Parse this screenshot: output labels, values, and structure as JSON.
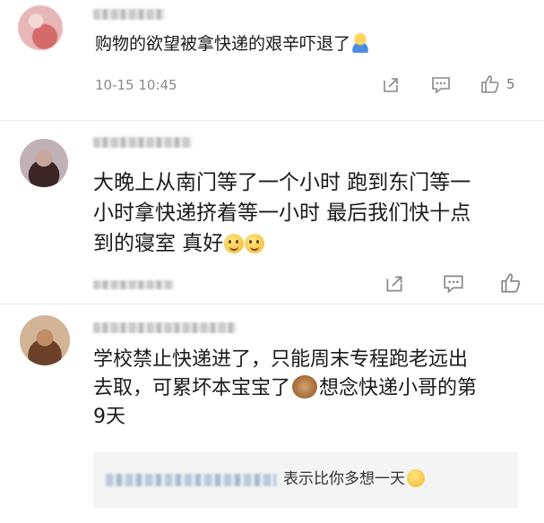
{
  "comments": [
    {
      "text": "购物的欲望被拿快递的艰辛吓退了",
      "emoji": "shrug-emoji",
      "timestamp": "10-15 10:45",
      "likes": "5"
    },
    {
      "lines": [
        "大晚上从南门等了一个小时 跑到东门等一",
        "小时拿快递挤着等一小时 最后我们快十点",
        "到的寝室 真好"
      ],
      "emoji": "smile-emoji"
    },
    {
      "lines": [
        "学校禁止快递进了，只能周末专程跑老远出",
        "去取，可累坏本宝宝了",
        "想念快递小哥的第",
        "9天"
      ],
      "emoji": "see-no-evil-monkey-emoji",
      "reply": {
        "text": "表示比你多想一天",
        "emoji": "laughing-tears-emoji"
      }
    }
  ],
  "colors": {
    "background": "#ffffff",
    "text": "#1a1a1a",
    "secondary": "#8a8a8a",
    "reply_bg": "#f4f4f4"
  }
}
